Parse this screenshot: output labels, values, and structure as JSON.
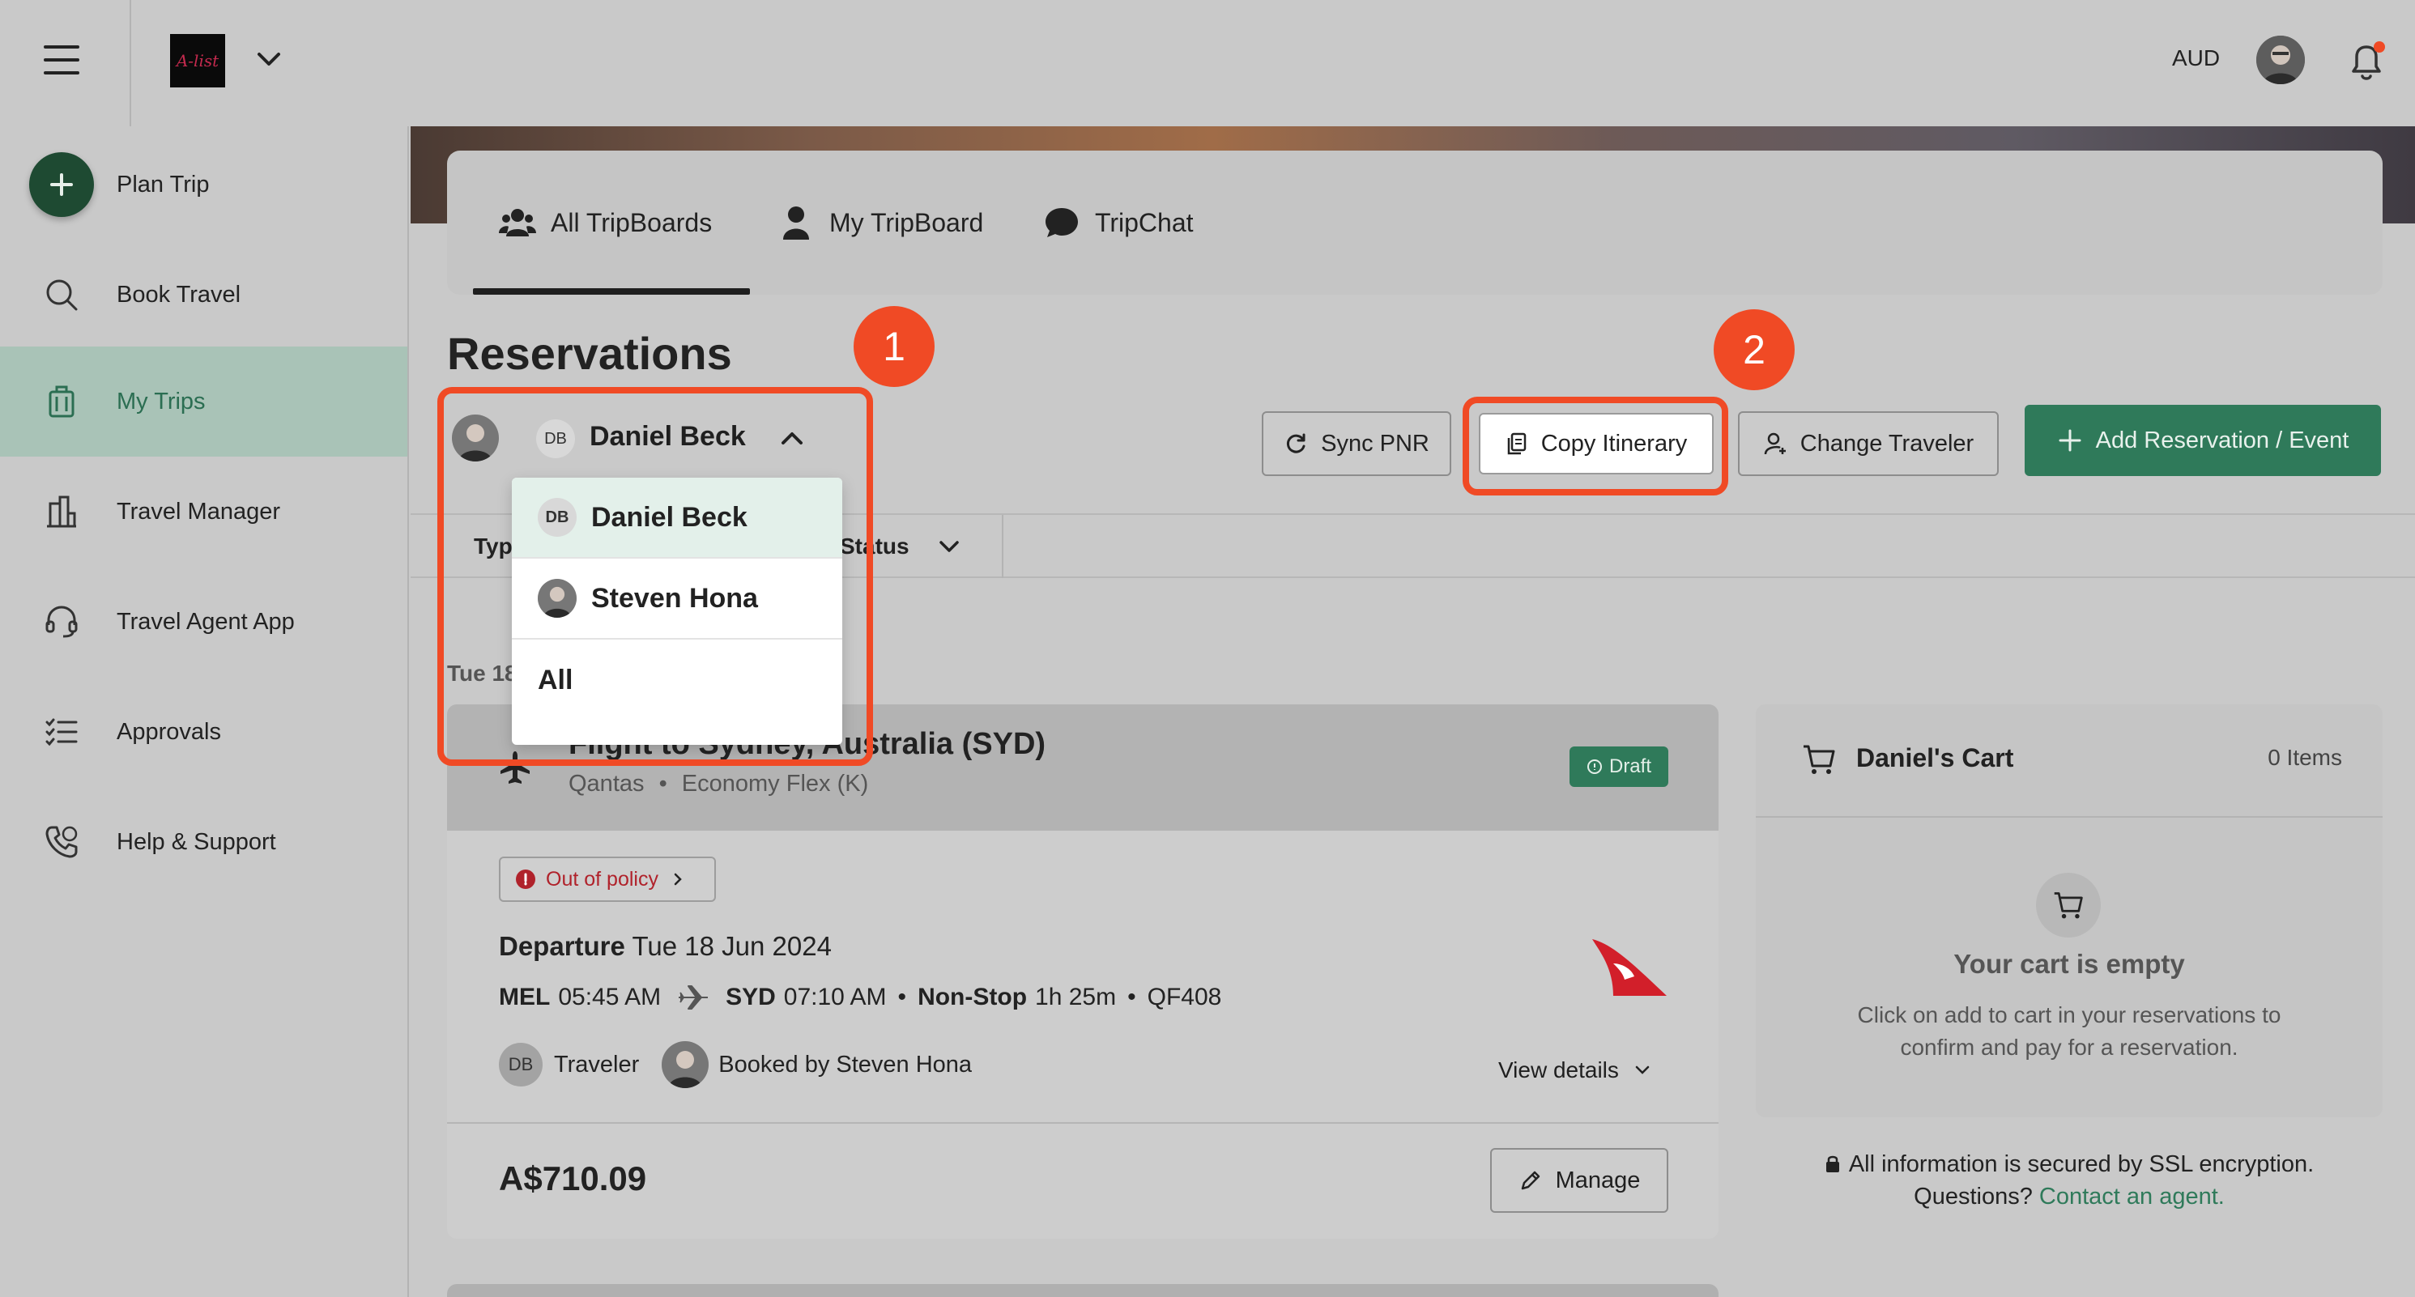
{
  "header": {
    "logo_text": "A-list",
    "currency": "AUD"
  },
  "sidebar": {
    "items": [
      {
        "label": "Plan Trip",
        "icon": "plus-icon"
      },
      {
        "label": "Book Travel",
        "icon": "search-icon"
      },
      {
        "label": "My Trips",
        "icon": "luggage-icon",
        "active": true
      },
      {
        "label": "Travel Manager",
        "icon": "buildings-icon"
      },
      {
        "label": "Travel Agent App",
        "icon": "headset-icon"
      },
      {
        "label": "Approvals",
        "icon": "checklist-icon"
      },
      {
        "label": "Help & Support",
        "icon": "phone-icon"
      }
    ]
  },
  "tabs": [
    {
      "label": "All TripBoards",
      "icon": "users-icon",
      "active": true
    },
    {
      "label": "My TripBoard",
      "icon": "user-icon"
    },
    {
      "label": "TripChat",
      "icon": "chat-icon"
    }
  ],
  "page_title": "Reservations",
  "traveler_select": {
    "initials": "DB",
    "selected": "Daniel Beck",
    "options": [
      {
        "initials": "DB",
        "label": "Daniel Beck"
      },
      {
        "initials": "",
        "label": "Steven Hona"
      },
      {
        "initials": "",
        "label": "All"
      }
    ]
  },
  "toolbar": {
    "sync_label": "Sync PNR",
    "copy_label": "Copy Itinerary",
    "change_label": "Change Traveler",
    "add_label": "Add Reservation / Event"
  },
  "annotations": {
    "badge1": "1",
    "badge2": "2"
  },
  "filters": {
    "type_label": "Typ",
    "status_label": "Status"
  },
  "date_label": "Tue 18",
  "reservation": {
    "title": "Flight to Sydney, Australia (SYD)",
    "airline": "Qantas",
    "fare": "Economy Flex (K)",
    "status": "Draft",
    "policy": "Out of policy",
    "departure_label": "Departure",
    "departure_date": "Tue 18 Jun 2024",
    "from_code": "MEL",
    "from_time": "05:45 AM",
    "to_code": "SYD",
    "to_time": "07:10 AM",
    "stops": "Non-Stop",
    "duration": "1h 25m",
    "flight_no": "QF408",
    "traveler_initials": "DB",
    "traveler_label": "Traveler",
    "booked_by": "Booked by Steven Hona",
    "view_details": "View details",
    "price": "A$710.09",
    "manage_label": "Manage"
  },
  "cart": {
    "title": "Daniel's Cart",
    "count": "0 Items",
    "empty_title": "Your cart is empty",
    "empty_text": "Click on add to cart in your reservations to confirm and pay for a reservation."
  },
  "security": {
    "line1": "All information is secured by SSL encryption.",
    "line2_prefix": "Questions?",
    "link": "Contact an agent."
  },
  "colors": {
    "accent": "#2f7a5a",
    "highlight": "#f04a25",
    "policy_red": "#b0222b"
  }
}
